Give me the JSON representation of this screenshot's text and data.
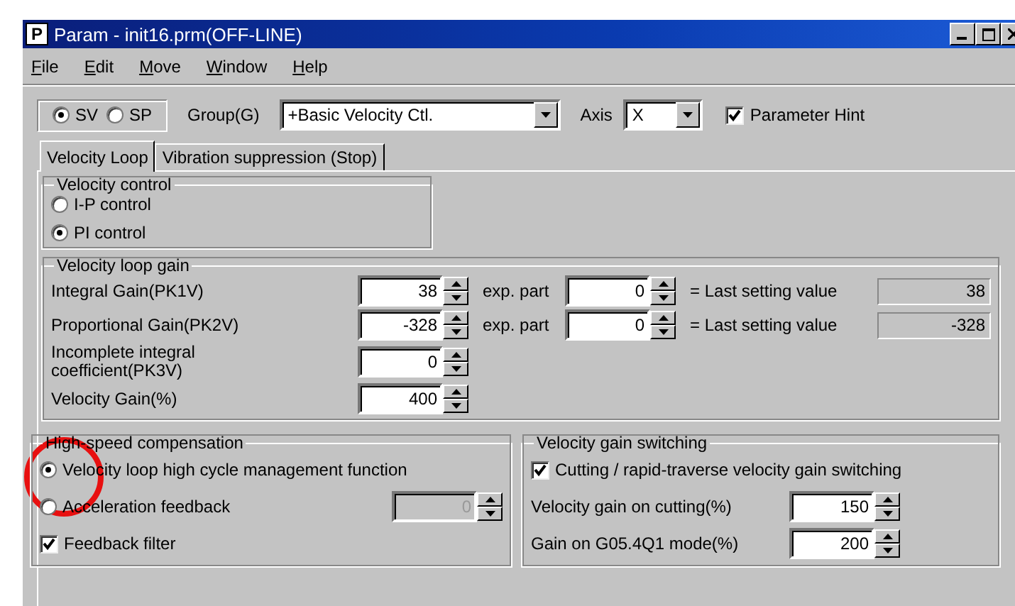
{
  "window": {
    "icon_letter": "P",
    "title": "Param - init16.prm(OFF-LINE)"
  },
  "menu": [
    "File",
    "Edit",
    "Move",
    "Window",
    "Help"
  ],
  "toolbar": {
    "modes": [
      {
        "label": "SV",
        "selected": true
      },
      {
        "label": "SP",
        "selected": false
      }
    ],
    "group_label": "Group(G)",
    "group_value": "+Basic Velocity Ctl.",
    "axis_label": "Axis",
    "axis_value": "X",
    "hint": {
      "label": "Parameter Hint",
      "checked": true
    }
  },
  "tabs": [
    {
      "label": "Velocity Loop",
      "selected": true
    },
    {
      "label": "Vibration suppression (Stop)",
      "selected": false
    }
  ],
  "velocity_control": {
    "title": "Velocity control",
    "options": [
      {
        "label": "I-P control",
        "selected": false
      },
      {
        "label": "PI control",
        "selected": true
      }
    ]
  },
  "velocity_loop_gain": {
    "title": "Velocity loop gain",
    "rows": [
      {
        "label": "Integral Gain(PK1V)",
        "value": "38",
        "exp_label": "exp. part",
        "exp_value": "0",
        "last_label": "= Last setting value",
        "last_value": "38"
      },
      {
        "label": "Proportional Gain(PK2V)",
        "value": "-328",
        "exp_label": "exp. part",
        "exp_value": "0",
        "last_label": "= Last setting value",
        "last_value": "-328"
      },
      {
        "label": "Incomplete integral coefficient(PK3V)",
        "value": "0"
      },
      {
        "label": "Velocity Gain(%)",
        "value": "400"
      }
    ]
  },
  "high_speed_compensation": {
    "title": "High-speed compensation",
    "items": [
      {
        "kind": "radio",
        "label": "Velocity loop high cycle management function",
        "selected": true
      },
      {
        "kind": "radio",
        "label": "Acceleration feedback",
        "selected": false,
        "field": {
          "value": "0",
          "disabled": true
        }
      },
      {
        "kind": "checkbox",
        "label": "Feedback filter",
        "checked": true
      }
    ]
  },
  "velocity_gain_switching": {
    "title": "Velocity gain switching",
    "switch": {
      "label": "Cutting / rapid-traverse velocity gain switching",
      "checked": true
    },
    "fields": [
      {
        "label": "Velocity gain on cutting(%)",
        "value": "150"
      },
      {
        "label": "Gain on G05.4Q1 mode(%)",
        "value": "200"
      }
    ]
  }
}
